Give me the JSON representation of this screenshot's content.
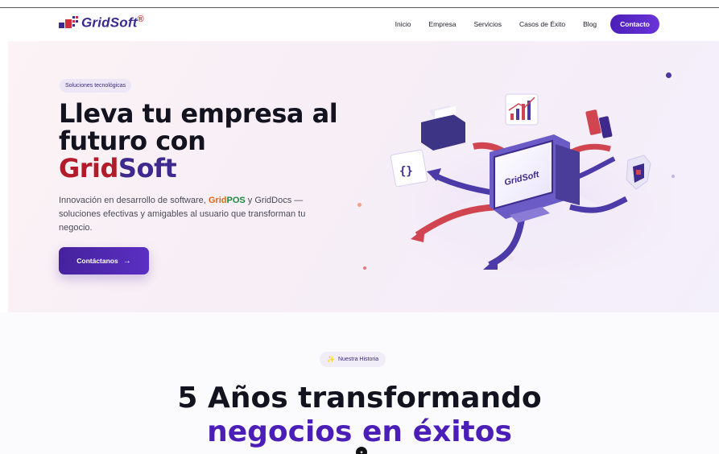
{
  "header": {
    "logo_text": "GridSoft",
    "logo_reg": "®",
    "nav": [
      "Inicio",
      "Empresa",
      "Servicios",
      "Casos de Éxito",
      "Blog"
    ],
    "cta": "Contacto"
  },
  "hero": {
    "badge": "Soluciones tecnológicas",
    "title_line1": "Lleva tu empresa al",
    "title_line2": "futuro con",
    "title_brand1": "Grid",
    "title_brand2": "Soft",
    "desc_part1": "Innovación en desarrollo de software, ",
    "desc_grid": "Grid",
    "desc_pos": "POS",
    "desc_part2": " y GridDocs — soluciones efectivas y amigables al usuario que transforman tu negocio.",
    "cta": "Contáctanos",
    "cta_arrow": "→",
    "illustration_brand": "GridSoft"
  },
  "story": {
    "badge_icon": "✨",
    "badge": "Nuestra Historia",
    "title_line1": "5 Años transformando",
    "title_line2": "negocios en éxitos"
  },
  "colors": {
    "primary": "#4b1fb7",
    "brand_red": "#b11b2a",
    "brand_navy": "#3e2a8c",
    "pos_orange": "#e06418",
    "pos_green": "#198c3a"
  }
}
